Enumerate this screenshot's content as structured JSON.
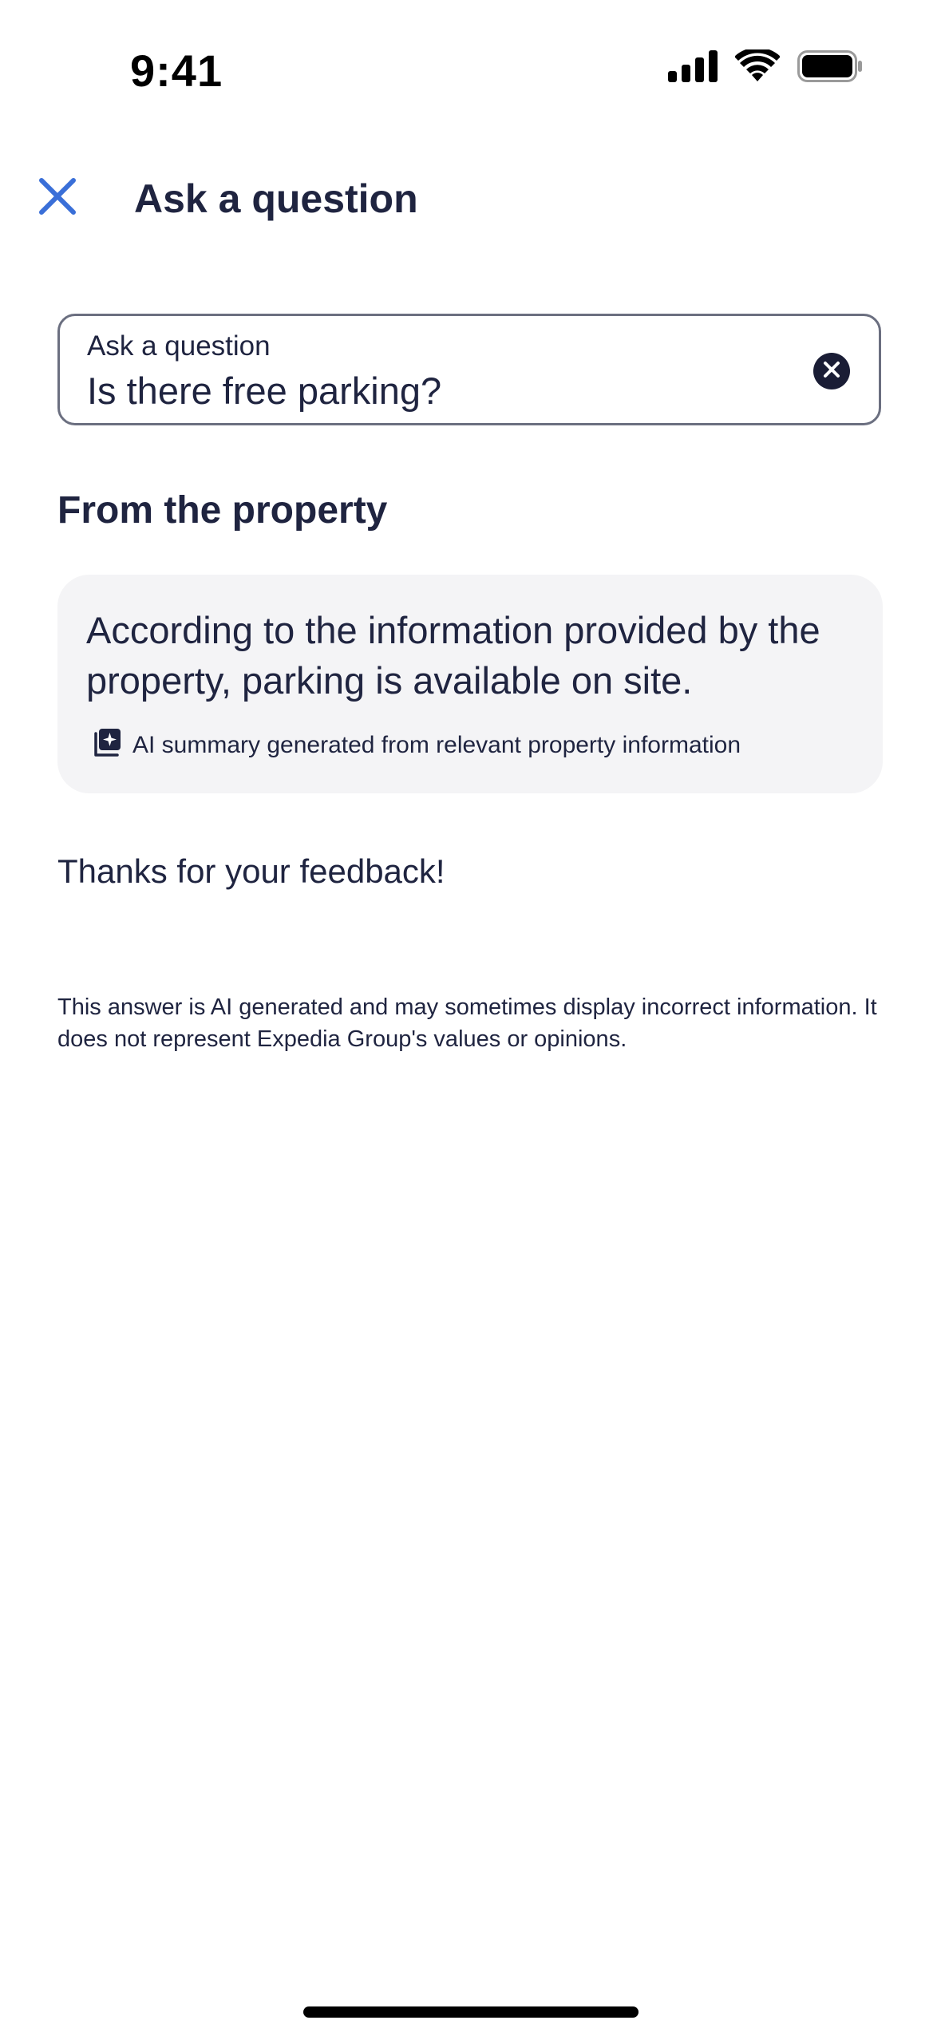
{
  "status_bar": {
    "time": "9:41",
    "icons": [
      "cellular-signal-icon",
      "wifi-icon",
      "battery-icon"
    ]
  },
  "header": {
    "close_icon": "close-icon",
    "title": "Ask a question"
  },
  "question_field": {
    "label": "Ask a question",
    "value": "Is there free parking?",
    "clear_icon": "clear-icon"
  },
  "section": {
    "title": "From the property"
  },
  "answer": {
    "text": "According to the information provided by the property, parking is available on site.",
    "ai_note": "AI summary generated from relevant property information",
    "ai_icon": "ai-sparkle-icon"
  },
  "feedback": {
    "text": "Thanks for your feedback!"
  },
  "disclaimer": {
    "text": "This answer is AI generated and may sometimes display incorrect information. It does not represent Expedia Group's values or opinions."
  },
  "colors": {
    "accent": "#3a6fd8",
    "text": "#1f2440",
    "card_bg": "#f4f4f6",
    "border": "#6b6f80"
  }
}
